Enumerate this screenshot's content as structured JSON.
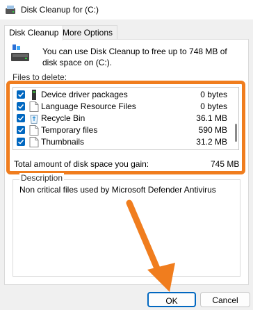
{
  "window": {
    "title": "Disk Cleanup for  (C:)"
  },
  "tabs": [
    {
      "label": "Disk Cleanup",
      "active": true
    },
    {
      "label": "More Options",
      "active": false
    }
  ],
  "intro": {
    "text": "You can use Disk Cleanup to free up to 748 MB of disk space on  (C:)."
  },
  "files": {
    "label": "Files to delete:",
    "items": [
      {
        "name": "Device driver packages",
        "size": "0 bytes",
        "checked": true,
        "icon": "driver-icon"
      },
      {
        "name": "Language Resource Files",
        "size": "0 bytes",
        "checked": true,
        "icon": "file-icon"
      },
      {
        "name": "Recycle Bin",
        "size": "36.1 MB",
        "checked": true,
        "icon": "recycle-bin-icon"
      },
      {
        "name": "Temporary files",
        "size": "590 MB",
        "checked": true,
        "icon": "file-icon"
      },
      {
        "name": "Thumbnails",
        "size": "31.2 MB",
        "checked": true,
        "icon": "file-icon"
      }
    ]
  },
  "total": {
    "label": "Total amount of disk space you gain:",
    "value": "745 MB"
  },
  "description": {
    "label": "Description",
    "text": "Non critical files used by Microsoft Defender Antivirus"
  },
  "buttons": {
    "ok": "OK",
    "cancel": "Cancel"
  },
  "colors": {
    "accent": "#0067c0",
    "highlight": "#f07d1e"
  }
}
